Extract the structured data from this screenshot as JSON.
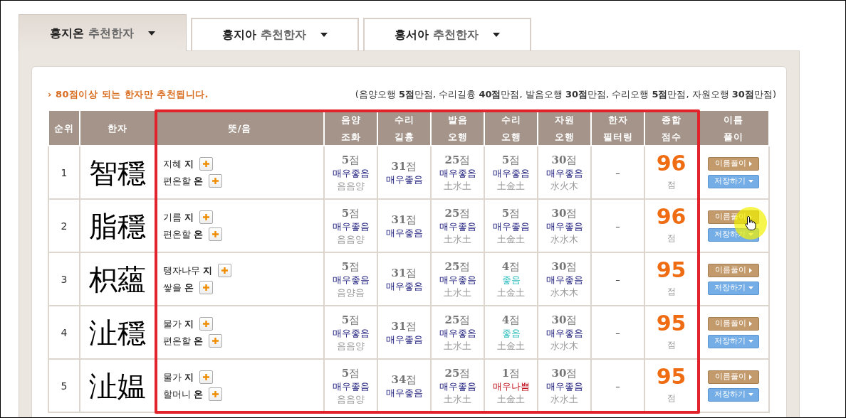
{
  "tabs": [
    {
      "name": "홍지온",
      "suffix": "추천한자",
      "selected": true
    },
    {
      "name": "홍지아",
      "suffix": "추천한자",
      "selected": false
    },
    {
      "name": "홍서아",
      "suffix": "추천한자",
      "selected": false
    }
  ],
  "notice": {
    "marker": "›",
    "text": "80점이상 되는 한자만 추천됩니다.",
    "max_scores": "(음양오행 **5점**만점, 수리길흉 **40점**만점, 발음오행 **30점**만점, 수리오행 **5점**만점, 자원오행 **30점**만점)"
  },
  "table": {
    "columns": [
      {
        "lines": [
          "순위"
        ]
      },
      {
        "lines": [
          "한자"
        ]
      },
      {
        "lines": [
          "뜻/음"
        ]
      },
      {
        "lines": [
          "음양",
          "조화"
        ]
      },
      {
        "lines": [
          "수리",
          "길흉"
        ]
      },
      {
        "lines": [
          "발음",
          "오행"
        ]
      },
      {
        "lines": [
          "수리",
          "오행"
        ]
      },
      {
        "lines": [
          "자원",
          "오행"
        ]
      },
      {
        "lines": [
          "한자",
          "필터링"
        ]
      },
      {
        "lines": [
          "종합",
          "점수"
        ]
      },
      {
        "lines": [
          "이름",
          "풀이"
        ]
      }
    ],
    "rows": [
      {
        "rank": "1",
        "hanja": "智穩",
        "meanings": [
          "지혜 **지**",
          "편온할 **온**"
        ],
        "scores": [
          {
            "points": "5",
            "unit": "점",
            "verdict": "매우좋음",
            "kind": "best",
            "detail": "음음양"
          },
          {
            "points": "31",
            "unit": "점",
            "verdict": "매우좋음",
            "kind": "best"
          },
          {
            "points": "25",
            "unit": "점",
            "verdict": "매우좋음",
            "kind": "best",
            "detail": "土水土"
          },
          {
            "points": "5",
            "unit": "점",
            "verdict": "매우좋음",
            "kind": "best",
            "detail": "土金土"
          },
          {
            "points": "30",
            "unit": "점",
            "verdict": "매우좋음",
            "kind": "best",
            "detail": "水火木"
          }
        ],
        "filter": "–",
        "total": "96",
        "total_unit": "점",
        "buttons": [
          "이름풀이",
          "저장하기"
        ],
        "hovered": false
      },
      {
        "rank": "2",
        "hanja": "脂穩",
        "meanings": [
          "기름 **지**",
          "편온할 **온**"
        ],
        "scores": [
          {
            "points": "5",
            "unit": "점",
            "verdict": "매우좋음",
            "kind": "best",
            "detail": "음음양"
          },
          {
            "points": "31",
            "unit": "점",
            "verdict": "매우좋음",
            "kind": "best"
          },
          {
            "points": "25",
            "unit": "점",
            "verdict": "매우좋음",
            "kind": "best",
            "detail": "土水土"
          },
          {
            "points": "5",
            "unit": "점",
            "verdict": "매우좋음",
            "kind": "best",
            "detail": "土金土"
          },
          {
            "points": "30",
            "unit": "점",
            "verdict": "매우좋음",
            "kind": "best",
            "detail": "水水木"
          }
        ],
        "filter": "–",
        "total": "96",
        "total_unit": "점",
        "buttons": [
          "이름풀이",
          "저장하기"
        ],
        "hovered": true
      },
      {
        "rank": "3",
        "hanja": "枳蘊",
        "meanings": [
          "탱자나무 **지**",
          "쌓을 **온**"
        ],
        "scores": [
          {
            "points": "5",
            "unit": "점",
            "verdict": "매우좋음",
            "kind": "best",
            "detail": "음양음"
          },
          {
            "points": "31",
            "unit": "점",
            "verdict": "매우좋음",
            "kind": "best"
          },
          {
            "points": "25",
            "unit": "점",
            "verdict": "매우좋음",
            "kind": "best",
            "detail": "土水土"
          },
          {
            "points": "4",
            "unit": "점",
            "verdict": "좋음",
            "kind": "good",
            "detail": "土金土"
          },
          {
            "points": "30",
            "unit": "점",
            "verdict": "매우좋음",
            "kind": "best",
            "detail": "水木木"
          }
        ],
        "filter": "–",
        "total": "95",
        "total_unit": "점",
        "buttons": [
          "이름풀이",
          "저장하기"
        ],
        "hovered": false
      },
      {
        "rank": "4",
        "hanja": "沚穩",
        "meanings": [
          "물가 **지**",
          "편온할 **온**"
        ],
        "scores": [
          {
            "points": "5",
            "unit": "점",
            "verdict": "매우좋음",
            "kind": "best",
            "detail": "음음양"
          },
          {
            "points": "31",
            "unit": "점",
            "verdict": "매우좋음",
            "kind": "best"
          },
          {
            "points": "25",
            "unit": "점",
            "verdict": "매우좋음",
            "kind": "best",
            "detail": "土水土"
          },
          {
            "points": "4",
            "unit": "점",
            "verdict": "좋음",
            "kind": "good",
            "detail": "土金土"
          },
          {
            "points": "30",
            "unit": "점",
            "verdict": "매우좋음",
            "kind": "best",
            "detail": "水水木"
          }
        ],
        "filter": "–",
        "total": "95",
        "total_unit": "점",
        "buttons": [
          "이름풀이",
          "저장하기"
        ],
        "hovered": false
      },
      {
        "rank": "5",
        "hanja": "沚媪",
        "meanings": [
          "물가 **지**",
          "할머니 **온**"
        ],
        "scores": [
          {
            "points": "5",
            "unit": "점",
            "verdict": "매우좋음",
            "kind": "best",
            "detail": "음음양"
          },
          {
            "points": "34",
            "unit": "점",
            "verdict": "매우좋음",
            "kind": "best"
          },
          {
            "points": "25",
            "unit": "점",
            "verdict": "매우좋음",
            "kind": "best",
            "detail": "土水土"
          },
          {
            "points": "1",
            "unit": "점",
            "verdict": "매우나쁨",
            "kind": "worst",
            "detail": "土金土"
          },
          {
            "points": "30",
            "unit": "점",
            "verdict": "매우좋음",
            "kind": "best",
            "detail": "水水土"
          }
        ],
        "filter": "–",
        "total": "95",
        "total_unit": "점",
        "buttons": [
          "이름풀이",
          "저장하기"
        ],
        "hovered": false
      }
    ]
  }
}
